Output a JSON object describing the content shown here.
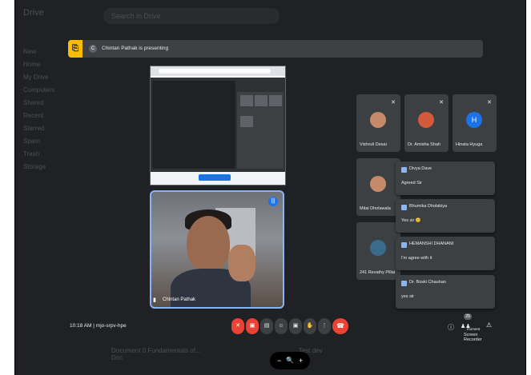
{
  "background_app": {
    "logo": "Drive",
    "search_placeholder": "Search in Drive",
    "sidebar": [
      "New",
      "Home",
      "My Drive",
      "Computers",
      "Shared",
      "Recent",
      "Starred",
      "Spam",
      "Trash",
      "Storage"
    ],
    "bottom_files": [
      "Document 0 Fundamentals of...",
      "Test dev",
      "Doc"
    ]
  },
  "meet": {
    "presenting_label": "Chintan Pathak is presenting",
    "presenter_initial": "C",
    "presenter_name": "Chintan Pathak",
    "time": "10:18 AM",
    "separator": "|",
    "meeting_code": "mjo-srpv-hpe",
    "participants": [
      {
        "name": "Vishruti Desai",
        "initial": ""
      },
      {
        "name": "Dr. Amisha Shah",
        "initial": ""
      },
      {
        "name": "Hinata Hyuga",
        "initial": "H"
      },
      {
        "name": "Mitai Dholawala",
        "initial": ""
      },
      {
        "name": "241 Revathy Pillai",
        "initial": ""
      }
    ],
    "chats": [
      {
        "sender": "Divya Dave",
        "message": "Agreed Sir"
      },
      {
        "sender": "Bhumika Dholakiya",
        "message": "Yes sir 😊"
      },
      {
        "sender": "HEMANSHI DHANANI",
        "message": "I'm agree with it"
      },
      {
        "sender": "Dr. Boski Chauhan",
        "message": "yes sir"
      }
    ],
    "participant_count": "29",
    "screen_recorder_label": "Screen Recorder",
    "moment_label": "moment"
  },
  "zoom": {
    "minus": "−",
    "icon": "🔍",
    "plus": "+"
  },
  "colors": {
    "accent": "#8ab4f8",
    "danger": "#ea4335",
    "present": "#fbbc04",
    "surface": "#3c4043",
    "bg": "#202124"
  }
}
